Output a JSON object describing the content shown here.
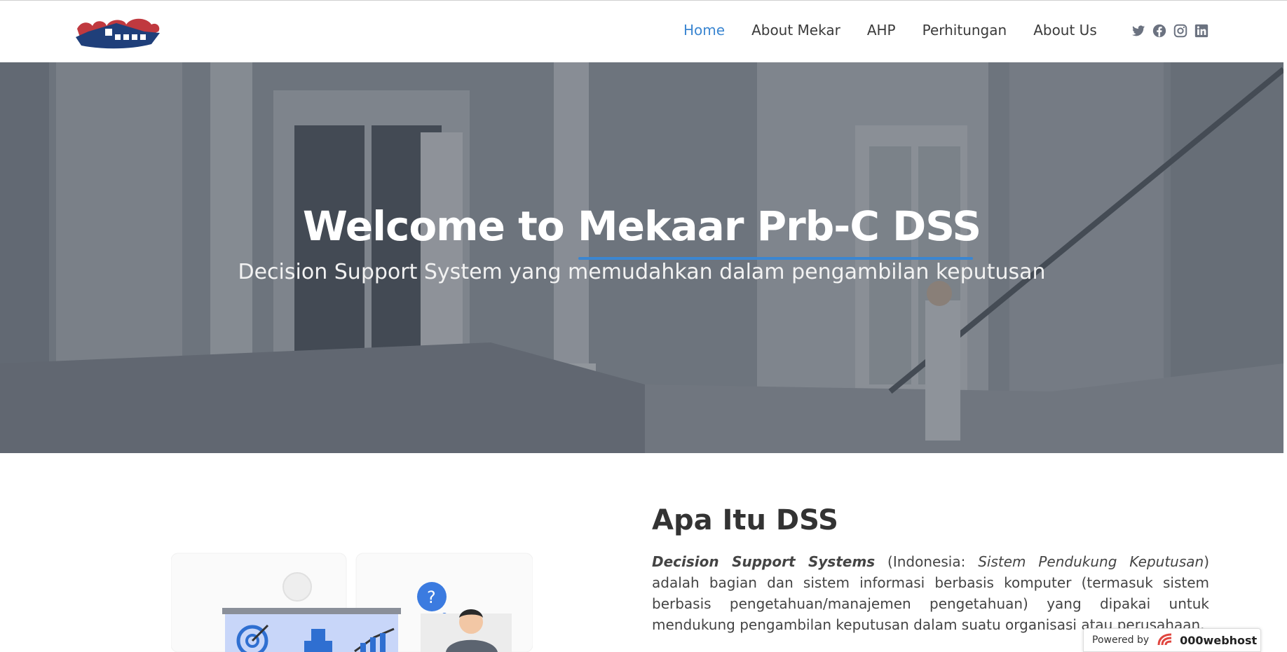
{
  "header": {
    "nav": [
      "Home",
      "About Mekar",
      "AHP",
      "Perhitungan",
      "About Us"
    ],
    "active_index": 0,
    "socials": [
      "twitter-icon",
      "facebook-icon",
      "instagram-icon",
      "linkedin-icon"
    ]
  },
  "hero": {
    "title": "Welcome to Mekaar Prb-C DSS",
    "subtitle": "Decision Support System yang memudahkan dalam pengambilan keputusan"
  },
  "about": {
    "title": "Apa Itu DSS",
    "term": "Decision Support Systems",
    "text_1": " (Indonesia: ",
    "term_id": "Sistem Pendukung Keputusan",
    "text_2": ") adalah bagian dan sistem informasi berbasis komputer (termasuk sistem berbasis pengetahuan/manajemen pengetahuan) yang dipakai untuk mendukung pengambilan keputusan dalam suatu organisasi atau perusahaan."
  },
  "badge": {
    "powered_label": "Powered by",
    "brand": "000webhost"
  },
  "colors": {
    "accent": "#3b86d1",
    "logo_red": "#c0393f",
    "logo_navy": "#1f3f7a"
  }
}
